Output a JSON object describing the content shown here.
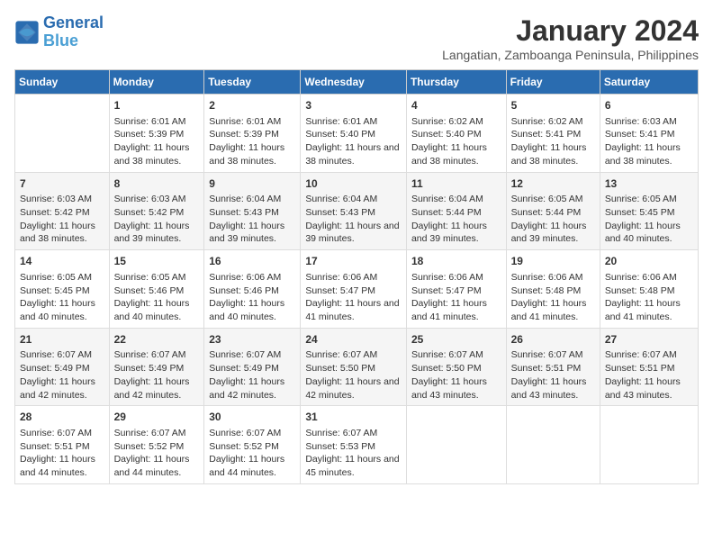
{
  "logo": {
    "line1": "General",
    "line2": "Blue"
  },
  "title": "January 2024",
  "subtitle": "Langatian, Zamboanga Peninsula, Philippines",
  "columns": [
    "Sunday",
    "Monday",
    "Tuesday",
    "Wednesday",
    "Thursday",
    "Friday",
    "Saturday"
  ],
  "weeks": [
    [
      {
        "day": "",
        "sunrise": "",
        "sunset": "",
        "daylight": ""
      },
      {
        "day": "1",
        "sunrise": "Sunrise: 6:01 AM",
        "sunset": "Sunset: 5:39 PM",
        "daylight": "Daylight: 11 hours and 38 minutes."
      },
      {
        "day": "2",
        "sunrise": "Sunrise: 6:01 AM",
        "sunset": "Sunset: 5:39 PM",
        "daylight": "Daylight: 11 hours and 38 minutes."
      },
      {
        "day": "3",
        "sunrise": "Sunrise: 6:01 AM",
        "sunset": "Sunset: 5:40 PM",
        "daylight": "Daylight: 11 hours and 38 minutes."
      },
      {
        "day": "4",
        "sunrise": "Sunrise: 6:02 AM",
        "sunset": "Sunset: 5:40 PM",
        "daylight": "Daylight: 11 hours and 38 minutes."
      },
      {
        "day": "5",
        "sunrise": "Sunrise: 6:02 AM",
        "sunset": "Sunset: 5:41 PM",
        "daylight": "Daylight: 11 hours and 38 minutes."
      },
      {
        "day": "6",
        "sunrise": "Sunrise: 6:03 AM",
        "sunset": "Sunset: 5:41 PM",
        "daylight": "Daylight: 11 hours and 38 minutes."
      }
    ],
    [
      {
        "day": "7",
        "sunrise": "Sunrise: 6:03 AM",
        "sunset": "Sunset: 5:42 PM",
        "daylight": "Daylight: 11 hours and 38 minutes."
      },
      {
        "day": "8",
        "sunrise": "Sunrise: 6:03 AM",
        "sunset": "Sunset: 5:42 PM",
        "daylight": "Daylight: 11 hours and 39 minutes."
      },
      {
        "day": "9",
        "sunrise": "Sunrise: 6:04 AM",
        "sunset": "Sunset: 5:43 PM",
        "daylight": "Daylight: 11 hours and 39 minutes."
      },
      {
        "day": "10",
        "sunrise": "Sunrise: 6:04 AM",
        "sunset": "Sunset: 5:43 PM",
        "daylight": "Daylight: 11 hours and 39 minutes."
      },
      {
        "day": "11",
        "sunrise": "Sunrise: 6:04 AM",
        "sunset": "Sunset: 5:44 PM",
        "daylight": "Daylight: 11 hours and 39 minutes."
      },
      {
        "day": "12",
        "sunrise": "Sunrise: 6:05 AM",
        "sunset": "Sunset: 5:44 PM",
        "daylight": "Daylight: 11 hours and 39 minutes."
      },
      {
        "day": "13",
        "sunrise": "Sunrise: 6:05 AM",
        "sunset": "Sunset: 5:45 PM",
        "daylight": "Daylight: 11 hours and 40 minutes."
      }
    ],
    [
      {
        "day": "14",
        "sunrise": "Sunrise: 6:05 AM",
        "sunset": "Sunset: 5:45 PM",
        "daylight": "Daylight: 11 hours and 40 minutes."
      },
      {
        "day": "15",
        "sunrise": "Sunrise: 6:05 AM",
        "sunset": "Sunset: 5:46 PM",
        "daylight": "Daylight: 11 hours and 40 minutes."
      },
      {
        "day": "16",
        "sunrise": "Sunrise: 6:06 AM",
        "sunset": "Sunset: 5:46 PM",
        "daylight": "Daylight: 11 hours and 40 minutes."
      },
      {
        "day": "17",
        "sunrise": "Sunrise: 6:06 AM",
        "sunset": "Sunset: 5:47 PM",
        "daylight": "Daylight: 11 hours and 41 minutes."
      },
      {
        "day": "18",
        "sunrise": "Sunrise: 6:06 AM",
        "sunset": "Sunset: 5:47 PM",
        "daylight": "Daylight: 11 hours and 41 minutes."
      },
      {
        "day": "19",
        "sunrise": "Sunrise: 6:06 AM",
        "sunset": "Sunset: 5:48 PM",
        "daylight": "Daylight: 11 hours and 41 minutes."
      },
      {
        "day": "20",
        "sunrise": "Sunrise: 6:06 AM",
        "sunset": "Sunset: 5:48 PM",
        "daylight": "Daylight: 11 hours and 41 minutes."
      }
    ],
    [
      {
        "day": "21",
        "sunrise": "Sunrise: 6:07 AM",
        "sunset": "Sunset: 5:49 PM",
        "daylight": "Daylight: 11 hours and 42 minutes."
      },
      {
        "day": "22",
        "sunrise": "Sunrise: 6:07 AM",
        "sunset": "Sunset: 5:49 PM",
        "daylight": "Daylight: 11 hours and 42 minutes."
      },
      {
        "day": "23",
        "sunrise": "Sunrise: 6:07 AM",
        "sunset": "Sunset: 5:49 PM",
        "daylight": "Daylight: 11 hours and 42 minutes."
      },
      {
        "day": "24",
        "sunrise": "Sunrise: 6:07 AM",
        "sunset": "Sunset: 5:50 PM",
        "daylight": "Daylight: 11 hours and 42 minutes."
      },
      {
        "day": "25",
        "sunrise": "Sunrise: 6:07 AM",
        "sunset": "Sunset: 5:50 PM",
        "daylight": "Daylight: 11 hours and 43 minutes."
      },
      {
        "day": "26",
        "sunrise": "Sunrise: 6:07 AM",
        "sunset": "Sunset: 5:51 PM",
        "daylight": "Daylight: 11 hours and 43 minutes."
      },
      {
        "day": "27",
        "sunrise": "Sunrise: 6:07 AM",
        "sunset": "Sunset: 5:51 PM",
        "daylight": "Daylight: 11 hours and 43 minutes."
      }
    ],
    [
      {
        "day": "28",
        "sunrise": "Sunrise: 6:07 AM",
        "sunset": "Sunset: 5:51 PM",
        "daylight": "Daylight: 11 hours and 44 minutes."
      },
      {
        "day": "29",
        "sunrise": "Sunrise: 6:07 AM",
        "sunset": "Sunset: 5:52 PM",
        "daylight": "Daylight: 11 hours and 44 minutes."
      },
      {
        "day": "30",
        "sunrise": "Sunrise: 6:07 AM",
        "sunset": "Sunset: 5:52 PM",
        "daylight": "Daylight: 11 hours and 44 minutes."
      },
      {
        "day": "31",
        "sunrise": "Sunrise: 6:07 AM",
        "sunset": "Sunset: 5:53 PM",
        "daylight": "Daylight: 11 hours and 45 minutes."
      },
      {
        "day": "",
        "sunrise": "",
        "sunset": "",
        "daylight": ""
      },
      {
        "day": "",
        "sunrise": "",
        "sunset": "",
        "daylight": ""
      },
      {
        "day": "",
        "sunrise": "",
        "sunset": "",
        "daylight": ""
      }
    ]
  ]
}
